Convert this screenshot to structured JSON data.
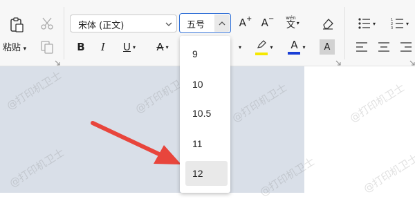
{
  "clipboard": {
    "paste_label": "粘贴"
  },
  "font": {
    "name": "宋体 (正文)",
    "size": "五号"
  },
  "format_buttons": {
    "bold": "B",
    "italic": "I",
    "underline": "U",
    "strike": "A",
    "highlight": "A",
    "font_color": "A",
    "char_shade": "A",
    "grow_font": "A",
    "shrink_font": "A",
    "phonetic": "wén",
    "phonetic_char": "文"
  },
  "size_dropdown": {
    "items": [
      "9",
      "10",
      "10.5",
      "11",
      "12"
    ],
    "selected": "12"
  },
  "watermark": "@打印机卫士",
  "colors": {
    "accent_blue": "#2f6fd6",
    "highlight_yellow": "#f5e800",
    "font_color_blue": "#1a3fd6",
    "arrow_red": "#e8453c",
    "doc_background": "#d9dfe8"
  }
}
